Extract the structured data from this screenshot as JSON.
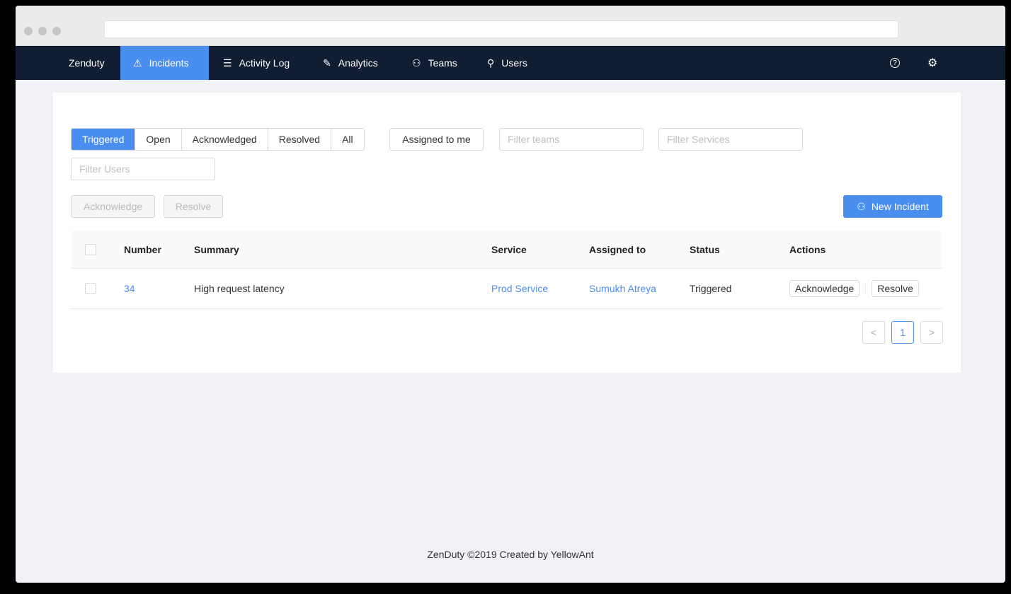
{
  "nav": {
    "brand": "Zenduty",
    "items": [
      {
        "label": "Incidents",
        "icon": "warning-triangle-icon",
        "glyph": "⚠"
      },
      {
        "label": "Activity Log",
        "icon": "document-icon",
        "glyph": "☰"
      },
      {
        "label": "Analytics",
        "icon": "wrench-icon",
        "glyph": "✎"
      },
      {
        "label": "Teams",
        "icon": "team-icon",
        "glyph": "⚇"
      },
      {
        "label": "Users",
        "icon": "user-icon",
        "glyph": "⚲"
      }
    ],
    "help_icon_glyph": "?",
    "settings_icon_glyph": "⚙"
  },
  "filters": {
    "status_tabs": [
      "Triggered",
      "Open",
      "Acknowledged",
      "Resolved",
      "All"
    ],
    "active_tab": "Triggered",
    "assigned_to_me": "Assigned to me",
    "filter_teams_placeholder": "Filter teams",
    "filter_services_placeholder": "Filter Services",
    "filter_users_placeholder": "Filter Users"
  },
  "actions": {
    "acknowledge": "Acknowledge",
    "resolve": "Resolve",
    "new_incident": "New Incident",
    "new_incident_glyph": "⚇"
  },
  "table": {
    "columns": [
      "Number",
      "Summary",
      "Service",
      "Assigned to",
      "Status",
      "Actions"
    ],
    "rows": [
      {
        "number": "34",
        "summary": "High request latency",
        "service": "Prod Service",
        "assigned_to": "Sumukh Atreya",
        "status": "Triggered",
        "acknowledge": "Acknowledge",
        "resolve": "Resolve"
      }
    ]
  },
  "pagination": {
    "prev": "<",
    "current": "1",
    "next": ">"
  },
  "footer": "ZenDuty ©2019 Created by YellowAnt",
  "colors": {
    "accent": "#4a8ef0",
    "navbar": "#111d33",
    "background": "#f0f2f5"
  }
}
